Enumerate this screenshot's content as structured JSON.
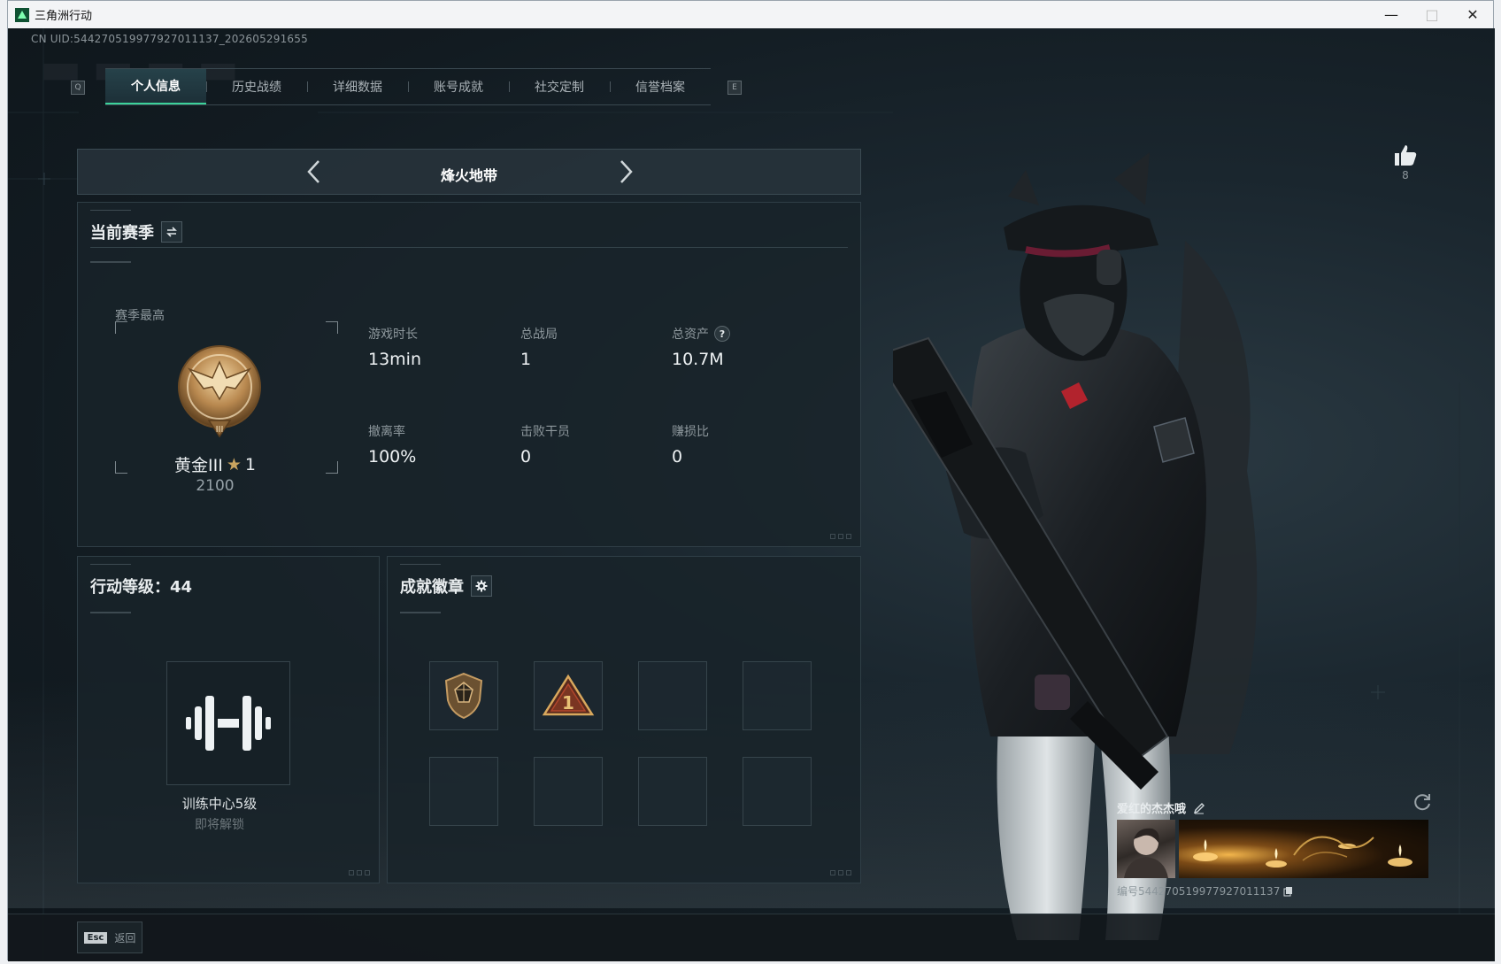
{
  "window": {
    "title": "三角洲行动",
    "min_icon": "minimize-icon",
    "max_icon": "maximize-icon",
    "close_icon": "close-icon"
  },
  "uid_line": "CN UID:544270519977927011137_202605291655",
  "tabs": [
    {
      "label": "个人信息",
      "active": true
    },
    {
      "label": "历史战绩",
      "active": false
    },
    {
      "label": "详细数据",
      "active": false
    },
    {
      "label": "账号成就",
      "active": false
    },
    {
      "label": "社交定制",
      "active": false
    },
    {
      "label": "信誉档案",
      "active": false
    }
  ],
  "tab_keys": {
    "left": "Q",
    "right": "E"
  },
  "mode": {
    "name": "烽火地带"
  },
  "season": {
    "title": "当前赛季",
    "best_label": "赛季最高",
    "rank_name": "黄金III",
    "rank_stars": "1",
    "rank_score": "2100",
    "stats": [
      {
        "label": "游戏时长",
        "value": "13min",
        "help": false
      },
      {
        "label": "总战局",
        "value": "1",
        "help": false
      },
      {
        "label": "总资产",
        "value": "10.7M",
        "help": true
      },
      {
        "label": "撤离率",
        "value": "100%",
        "help": false
      },
      {
        "label": "击败干员",
        "value": "0",
        "help": false
      },
      {
        "label": "赚损比",
        "value": "0",
        "help": false
      }
    ],
    "help_mark": "?"
  },
  "level": {
    "title": "行动等级：44",
    "unlock_name": "训练中心5级",
    "unlock_status": "即将解锁"
  },
  "badges": {
    "title": "成就徽章",
    "slots": 8
  },
  "likes": {
    "count": "8"
  },
  "profile": {
    "name": "爱红的杰杰哦",
    "id_text": "编号544270519977927011137"
  },
  "footer": {
    "esc_key": "Esc",
    "back_label": "返回"
  },
  "colors": {
    "accent": "#3cd29a",
    "bg": "#11181d",
    "panel": "#18232a"
  }
}
